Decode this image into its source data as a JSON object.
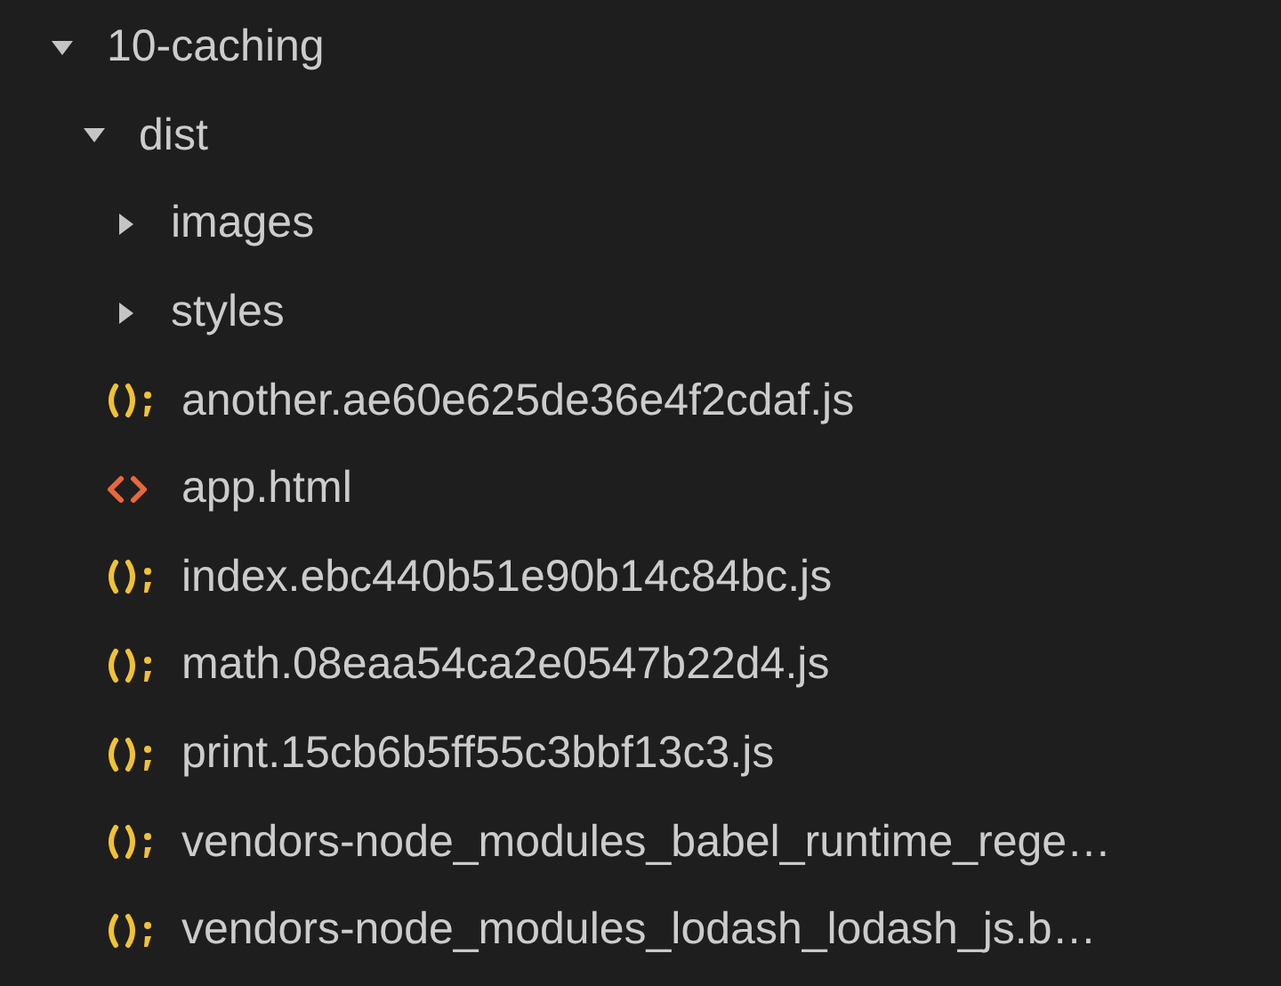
{
  "explorer": {
    "tree": [
      {
        "name": "10-caching",
        "kind": "folder",
        "expanded": true,
        "children": [
          {
            "name": "dist",
            "kind": "folder",
            "expanded": true,
            "children": [
              {
                "name": "images",
                "kind": "folder",
                "expanded": false
              },
              {
                "name": "styles",
                "kind": "folder",
                "expanded": false
              },
              {
                "name": "another.ae60e625de36e4f2cdaf.js",
                "kind": "js"
              },
              {
                "name": "app.html",
                "kind": "html"
              },
              {
                "name": "index.ebc440b51e90b14c84bc.js",
                "kind": "js"
              },
              {
                "name": "math.08eaa54ca2e0547b22d4.js",
                "kind": "js"
              },
              {
                "name": "print.15cb6b5ff55c3bbf13c3.js",
                "kind": "js"
              },
              {
                "name": "vendors-node_modules_babel_runtime_rege…",
                "kind": "js"
              },
              {
                "name": "vendors-node_modules_lodash_lodash_js.b…",
                "kind": "js"
              }
            ]
          }
        ]
      }
    ]
  }
}
